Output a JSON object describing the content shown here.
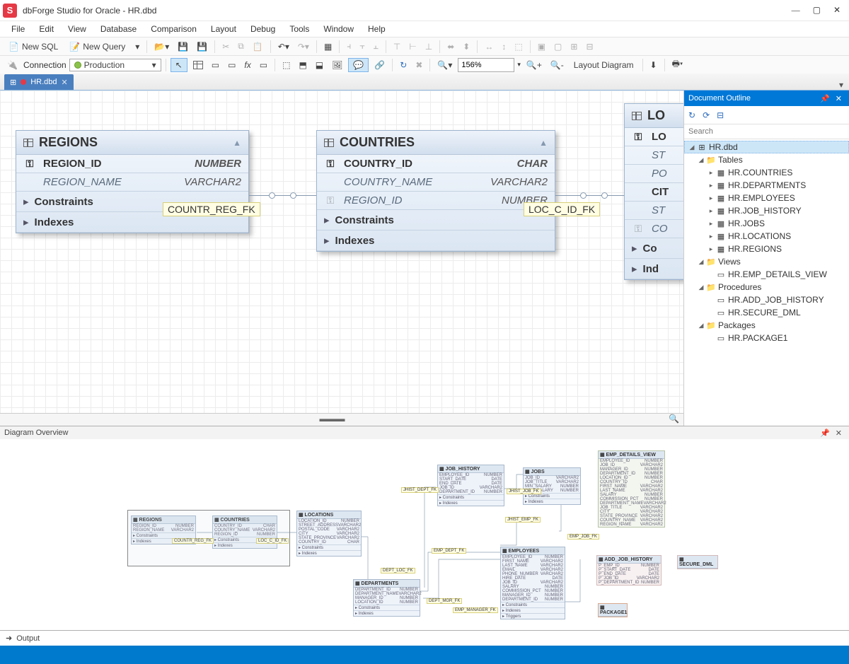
{
  "app": {
    "title": "dbForge Studio for Oracle - HR.dbd",
    "icon_letter": "S"
  },
  "menu": [
    "File",
    "Edit",
    "View",
    "Database",
    "Comparison",
    "Layout",
    "Debug",
    "Tools",
    "Window",
    "Help"
  ],
  "toolbar1": {
    "new_sql": "New SQL",
    "new_query": "New Query"
  },
  "toolbar2": {
    "connection_label": "Connection",
    "connection_value": "Production",
    "zoom": "156%",
    "layout_btn": "Layout Diagram"
  },
  "tab": {
    "name": "HR.dbd"
  },
  "entities": {
    "regions": {
      "title": "REGIONS",
      "cols": [
        {
          "name": "REGION_ID",
          "type": "NUMBER",
          "pk": true
        },
        {
          "name": "REGION_NAME",
          "type": "VARCHAR2"
        }
      ],
      "sections": [
        "Constraints",
        "Indexes"
      ]
    },
    "countries": {
      "title": "COUNTRIES",
      "cols": [
        {
          "name": "COUNTRY_ID",
          "type": "CHAR",
          "pk": true
        },
        {
          "name": "COUNTRY_NAME",
          "type": "VARCHAR2"
        },
        {
          "name": "REGION_ID",
          "type": "NUMBER",
          "fk": true
        }
      ],
      "sections": [
        "Constraints",
        "Indexes"
      ]
    },
    "locations_cut": {
      "title": "LO",
      "cols": [
        {
          "name": "LO",
          "pk": true
        },
        {
          "name": "ST"
        },
        {
          "name": "PO"
        },
        {
          "name": "CIT"
        },
        {
          "name": "ST"
        },
        {
          "name": "CO",
          "fk": true
        }
      ],
      "sections": [
        "Co",
        "Ind"
      ]
    }
  },
  "relations": {
    "countr_reg": "COUNTR_REG_FK",
    "loc_c_id": "LOC_C_ID_FK"
  },
  "outline": {
    "title": "Document Outline",
    "search_placeholder": "Search",
    "root": "HR.dbd",
    "groups": {
      "tables": {
        "label": "Tables",
        "items": [
          "HR.COUNTRIES",
          "HR.DEPARTMENTS",
          "HR.EMPLOYEES",
          "HR.JOB_HISTORY",
          "HR.JOBS",
          "HR.LOCATIONS",
          "HR.REGIONS"
        ]
      },
      "views": {
        "label": "Views",
        "items": [
          "HR.EMP_DETAILS_VIEW"
        ]
      },
      "procedures": {
        "label": "Procedures",
        "items": [
          "HR.ADD_JOB_HISTORY",
          "HR.SECURE_DML"
        ]
      },
      "packages": {
        "label": "Packages",
        "items": [
          "HR.PACKAGE1"
        ]
      }
    }
  },
  "overview": {
    "title": "Diagram Overview",
    "entities": {
      "regions": {
        "title": "REGIONS",
        "rows": [
          [
            "REGION_ID",
            "NUMBER"
          ],
          [
            "REGION_NAME",
            "VARCHAR2"
          ]
        ],
        "secs": [
          "Constraints",
          "Indexes"
        ]
      },
      "countries": {
        "title": "COUNTRIES",
        "rows": [
          [
            "COUNTRY_ID",
            "CHAR"
          ],
          [
            "COUNTRY_NAME",
            "VARCHAR2"
          ],
          [
            "REGION_ID",
            "NUMBER"
          ]
        ],
        "secs": [
          "Constraints",
          "Indexes"
        ]
      },
      "locations": {
        "title": "LOCATIONS",
        "rows": [
          [
            "LOCATION_ID",
            "NUMBER"
          ],
          [
            "STREET_ADDRESS",
            "VARCHAR2"
          ],
          [
            "POSTAL_CODE",
            "VARCHAR2"
          ],
          [
            "CITY",
            "VARCHAR2"
          ],
          [
            "STATE_PROVINCE",
            "VARCHAR2"
          ],
          [
            "COUNTRY_ID",
            "CHAR"
          ]
        ],
        "secs": [
          "Constraints",
          "Indexes"
        ]
      },
      "departments": {
        "title": "DEPARTMENTS",
        "rows": [
          [
            "DEPARTMENT_ID",
            "NUMBER"
          ],
          [
            "DEPARTMENT_NAME",
            "VARCHAR2"
          ],
          [
            "MANAGER_ID",
            "NUMBER"
          ],
          [
            "LOCATION_ID",
            "NUMBER"
          ]
        ],
        "secs": [
          "Constraints",
          "Indexes"
        ]
      },
      "job_history": {
        "title": "JOB_HISTORY",
        "rows": [
          [
            "EMPLOYEE_ID",
            "NUMBER"
          ],
          [
            "START_DATE",
            "DATE"
          ],
          [
            "END_DATE",
            "DATE"
          ],
          [
            "JOB_ID",
            "VARCHAR2"
          ],
          [
            "DEPARTMENT_ID",
            "NUMBER"
          ]
        ],
        "secs": [
          "Constraints",
          "Indexes"
        ]
      },
      "jobs": {
        "title": "JOBS",
        "rows": [
          [
            "JOB_ID",
            "VARCHAR2"
          ],
          [
            "JOB_TITLE",
            "VARCHAR2"
          ],
          [
            "MIN_SALARY",
            "NUMBER"
          ],
          [
            "MAX_SALARY",
            "NUMBER"
          ]
        ],
        "secs": [
          "Constraints",
          "Indexes"
        ]
      },
      "employees": {
        "title": "EMPLOYEES",
        "rows": [
          [
            "EMPLOYEE_ID",
            "NUMBER"
          ],
          [
            "FIRST_NAME",
            "VARCHAR2"
          ],
          [
            "LAST_NAME",
            "VARCHAR2"
          ],
          [
            "EMAIL",
            "VARCHAR2"
          ],
          [
            "PHONE_NUMBER",
            "VARCHAR2"
          ],
          [
            "HIRE_DATE",
            "DATE"
          ],
          [
            "JOB_ID",
            "VARCHAR2"
          ],
          [
            "SALARY",
            "NUMBER"
          ],
          [
            "COMMISSION_PCT",
            "NUMBER"
          ],
          [
            "MANAGER_ID",
            "NUMBER"
          ],
          [
            "DEPARTMENT_ID",
            "NUMBER"
          ]
        ],
        "secs": [
          "Constraints",
          "Indexes",
          "Triggers"
        ]
      },
      "emp_details_view": {
        "title": "EMP_DETAILS_VIEW",
        "rows": [
          [
            "EMPLOYEE_ID",
            "NUMBER"
          ],
          [
            "JOB_ID",
            "VARCHAR2"
          ],
          [
            "MANAGER_ID",
            "NUMBER"
          ],
          [
            "DEPARTMENT_ID",
            "NUMBER"
          ],
          [
            "LOCATION_ID",
            "NUMBER"
          ],
          [
            "COUNTRY_ID",
            "CHAR"
          ],
          [
            "FIRST_NAME",
            "VARCHAR2"
          ],
          [
            "LAST_NAME",
            "VARCHAR2"
          ],
          [
            "SALARY",
            "NUMBER"
          ],
          [
            "COMMISSION_PCT",
            "NUMBER"
          ],
          [
            "DEPARTMENT_NAME",
            "VARCHAR2"
          ],
          [
            "JOB_TITLE",
            "VARCHAR2"
          ],
          [
            "CITY",
            "VARCHAR2"
          ],
          [
            "STATE_PROVINCE",
            "VARCHAR2"
          ],
          [
            "COUNTRY_NAME",
            "VARCHAR2"
          ],
          [
            "REGION_NAME",
            "VARCHAR2"
          ]
        ]
      },
      "add_job_history": {
        "title": "ADD_JOB_HISTORY",
        "rows": [
          [
            "P_EMP_ID",
            "NUMBER"
          ],
          [
            "P_START_DATE",
            "DATE"
          ],
          [
            "P_END_DATE",
            "DATE"
          ],
          [
            "P_JOB_ID",
            "VARCHAR2"
          ],
          [
            "P_DEPARTMENT_ID",
            "NUMBER"
          ]
        ]
      },
      "secure_dml": {
        "title": "SECURE_DML"
      },
      "package1": {
        "title": "PACKAGE1"
      }
    },
    "labels": {
      "countr_reg": "COUNTR_REG_FK",
      "loc_c_id": "LOC_C_ID_FK",
      "dept_loc": "DEPT_LOC_FK",
      "dept_mgr": "DEPT_MGR_FK",
      "jhist_dept": "JHIST_DEPT_FK",
      "jhist_job": "JHIST_JOB_FK",
      "jhist_emp": "JHIST_EMP_FK",
      "emp_dept": "EMP_DEPT_FK",
      "emp_job": "EMP_JOB_FK",
      "emp_manager": "EMP_MANAGER_FK"
    }
  },
  "output": {
    "label": "Output"
  }
}
